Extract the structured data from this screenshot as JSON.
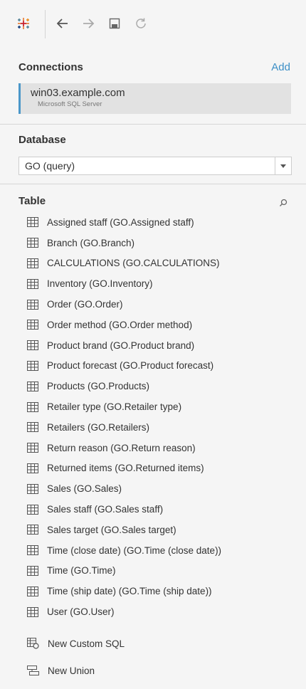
{
  "toolbar": {
    "icons": [
      "tableau-logo-icon",
      "back-arrow-icon",
      "forward-arrow-icon",
      "save-icon",
      "refresh-icon"
    ]
  },
  "connections": {
    "title": "Connections",
    "add_label": "Add",
    "items": [
      {
        "name": "win03.example.com",
        "type": "Microsoft SQL Server"
      }
    ]
  },
  "database": {
    "title": "Database",
    "selected": "GO (query)"
  },
  "table": {
    "title": "Table",
    "items": [
      "Assigned staff (GO.Assigned staff)",
      "Branch (GO.Branch)",
      "CALCULATIONS (GO.CALCULATIONS)",
      "Inventory (GO.Inventory)",
      "Order (GO.Order)",
      "Order method (GO.Order method)",
      "Product brand (GO.Product brand)",
      "Product forecast (GO.Product forecast)",
      "Products (GO.Products)",
      "Retailer type (GO.Retailer type)",
      "Retailers (GO.Retailers)",
      "Return reason (GO.Return reason)",
      "Returned items (GO.Returned items)",
      "Sales (GO.Sales)",
      "Sales staff (GO.Sales staff)",
      "Sales target (GO.Sales target)",
      "Time (close date) (GO.Time (close date))",
      "Time (GO.Time)",
      "Time (ship date) (GO.Time (ship date))",
      "User (GO.User)"
    ]
  },
  "extras": {
    "custom_sql_label": "New Custom SQL",
    "union_label": "New Union"
  },
  "colors": {
    "accent": "#3c8fc6",
    "connection_bar": "#4b97c9",
    "panel_bg": "#f5f5f5"
  }
}
